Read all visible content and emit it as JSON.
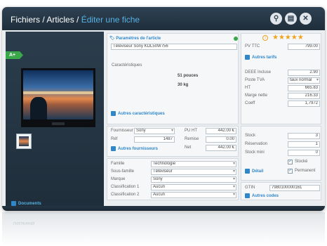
{
  "breadcrumb": {
    "part1": "Fichiers",
    "sep1": " / ",
    "part2": "Articles",
    "sep2": " / ",
    "current": "Éditer une fiche"
  },
  "title_buttons": [
    {
      "name": "search",
      "glyph": "⚲"
    },
    {
      "name": "save",
      "glyph": "▤"
    },
    {
      "name": "close",
      "glyph": "✕"
    }
  ],
  "energy_badge": "A+",
  "rating_stars": "★★★★★",
  "left_panel": {
    "documents_link": "Documents"
  },
  "article": {
    "section_title": "Paramètres de l'article",
    "name_value": "Téléviseur Sony KDL50W756",
    "characteristics_label": "Caractéristiques",
    "size_value": "51 pouces",
    "weight_value": "30 kg",
    "more_characteristics": "Autres caractéristiques"
  },
  "supplier": {
    "supplier_label": "Fournisseur",
    "supplier_value": "Sony",
    "ref_label": "Réf",
    "ref_value": "1487",
    "pu_ht_label": "PU HT",
    "pu_ht_value": "442.00 €",
    "remise_label": "Remise",
    "remise_value": "0.00",
    "net_label": "Net",
    "net_value": "442.00 €",
    "more_suppliers": "Autres fournisseurs"
  },
  "classification": {
    "famille_label": "Famille",
    "famille_value": "Technologie",
    "sousfamille_label": "Sous-famille",
    "sousfamille_value": "Téléviseur",
    "marque_label": "Marque",
    "marque_value": "Sony",
    "classif1_label": "Classification 1",
    "classif1_value": "Aucun",
    "classif2_label": "Classification 2",
    "classif2_value": "Aucun"
  },
  "pricing": {
    "pv_ttc_label": "PV TTC",
    "pv_ttc_value": "799.00",
    "more_tarifs": "Autres tarifs",
    "deee_label": "DEEE Incluse",
    "deee_value": "2.90",
    "tva_label": "Poste TVA",
    "tva_value": "taux normal",
    "ht_label": "HT",
    "ht_value": "665.83",
    "marge_label": "Marge nette",
    "marge_value": "216.33",
    "coeff_label": "Coeff",
    "coeff_value": "1,7972"
  },
  "stock": {
    "stock_label": "Stock",
    "stock_value": "3",
    "reservation_label": "Réservation",
    "reservation_value": "1",
    "stock_min_label": "Stock mini",
    "stock_min_value": "0",
    "stocke_label": "Stocké",
    "detail_link": "Détail",
    "permanent_label": "Permanent"
  },
  "codes": {
    "gtin_label": "GTIN",
    "gtin_value": "7980100000161",
    "more_codes": "Autres codes"
  },
  "colors": {
    "accent": "#2f87c9",
    "title": "#56b1e4",
    "green": "#3aa84a",
    "star": "#f0a31e"
  }
}
